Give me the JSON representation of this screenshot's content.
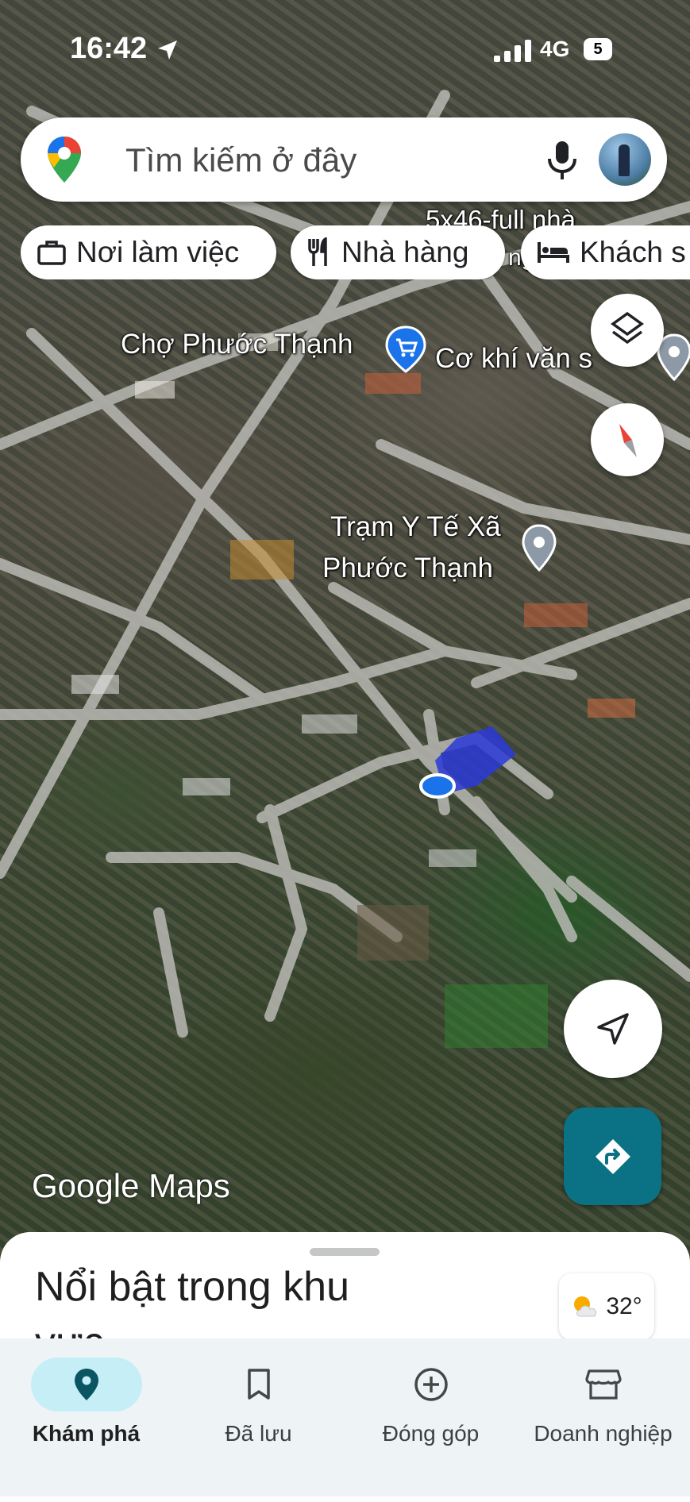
{
  "status_bar": {
    "time": "16:42",
    "network": "4G",
    "battery": "5"
  },
  "search": {
    "placeholder": "Tìm kiếm ở đây"
  },
  "chips": [
    {
      "label": "Nơi làm việc",
      "icon": "briefcase-icon"
    },
    {
      "label": "Nhà hàng",
      "icon": "restaurant-icon"
    },
    {
      "label": "Khách s",
      "icon": "hotel-icon"
    }
  ],
  "map": {
    "overlay_text": "5x46-full nhà",
    "overlay_text2": "ng",
    "places": [
      {
        "name": "Chợ Phước Thạnh",
        "icon": "shopping-cart-pin-icon"
      },
      {
        "name": "Cơ khí văn s",
        "icon": "place-pin-icon"
      },
      {
        "name_line1": "Trạm Y Tế Xã",
        "name_line2": "Phước Thạnh",
        "icon": "place-pin-icon"
      }
    ],
    "watermark": "Google Maps"
  },
  "sheet": {
    "title": "Nổi bật trong khu vực",
    "temperature": "32°"
  },
  "bottom_nav": [
    {
      "label": "Khám phá",
      "icon": "explore-pin-icon",
      "active": true
    },
    {
      "label": "Đã lưu",
      "icon": "bookmark-icon",
      "active": false
    },
    {
      "label": "Đóng góp",
      "icon": "add-circle-icon",
      "active": false
    },
    {
      "label": "Doanh nghiệp",
      "icon": "storefront-icon",
      "active": false
    }
  ],
  "colors": {
    "accent": "#0b7285",
    "active_nav_bg": "#c6eef7",
    "location_dot": "#1a73e8"
  }
}
